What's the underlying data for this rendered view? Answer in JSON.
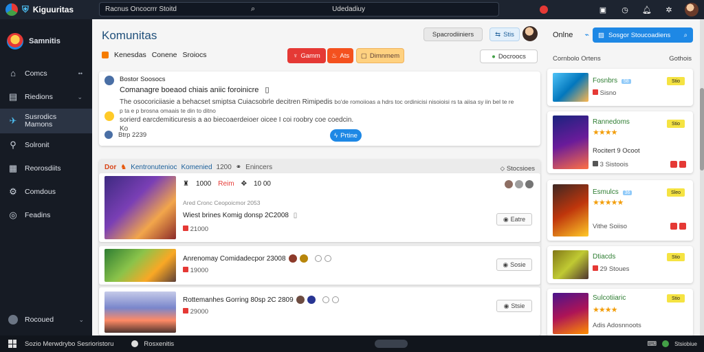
{
  "app": {
    "title": "Kiguuritas"
  },
  "search": {
    "query": "Racnus Oncocrrr Stoitd",
    "center": "Udedadiuy"
  },
  "sidebar": {
    "brand": "Samnitis",
    "items": [
      {
        "label": "Comcs",
        "icon": "home-icon"
      },
      {
        "label": "Riedions",
        "icon": "briefcase-icon"
      },
      {
        "label": "Susrodics Mamons",
        "icon": "controller-icon"
      },
      {
        "label": "Solronit",
        "icon": "wrench-icon"
      },
      {
        "label": "Reorosdiits",
        "icon": "shop-icon"
      },
      {
        "label": "Comdous",
        "icon": "gear-icon"
      },
      {
        "label": "Feadins",
        "icon": "target-icon"
      }
    ],
    "footer": "Rocoued"
  },
  "main": {
    "title": "Komunitas",
    "header_btn1": "Spacrodiiniers",
    "header_btn2": "Stis",
    "tabs_label1": "Kenesdas",
    "tabs_label2": "Conene",
    "tabs_label3": "Sroiocs",
    "pill1": "Gamm",
    "pill2": "Ats",
    "pill3": "Dimnmem",
    "pill4": "Docroocs",
    "colors": {
      "pill1": "#e53935",
      "pill2": "#f4511e",
      "pill3": "#ffd180",
      "accent": "#1e88e5"
    },
    "post": {
      "name": "Bostor Soosocs",
      "title": "Comanagre boeaod chiais aniic foroinicre",
      "body1": "The osocoriciiasie a behacset smiptsa Cuiacsobrle decitren Rimipedis ",
      "body_right": "bo'de romoiioas a hdrs toc ordinicisi nisoioisi rs ta aiisa sy iin bel te re p ta e p brosna omaais te din to ditno",
      "body2": "sorierd earcdemiticuresis a ao biecoaerdeioer oicee I coi roobry coe coedcin.",
      "body3": "Ko",
      "date": "Btrp 2239",
      "action": "Prtine"
    },
    "feed": {
      "label1": "Dor",
      "label2": "Kentronutenioc",
      "label3": "Komenied",
      "label4": "1200",
      "label5": "Enincers",
      "right": "Stocsioes",
      "rows": [
        {
          "line1a": "1000",
          "line1b": "Reim",
          "line1c": "10 00",
          "meta": "Ared Cronc Ceopoicmor 2053",
          "title": "Wiest brines Komig donsp 2C2008",
          "sub": "21000",
          "btn": "Eatre"
        },
        {
          "title": "Anrenomay Comidadecpor 23008",
          "sub": "19000",
          "btn": "Sosie"
        },
        {
          "title": "Rottemanhes Gorring 80sp 2C 2809",
          "sub": "29000",
          "btn": "Stsie"
        }
      ]
    }
  },
  "right": {
    "online": "Onlne",
    "search": "Sosgor Stoucoadiens",
    "sub1": "Cornbolo Ortens",
    "sub2": "Gothois",
    "games": [
      {
        "name": "Fosnbrs",
        "tag": "58",
        "sub": "Sisno",
        "badge": "Stio"
      },
      {
        "name": "Rannedoms",
        "tag": "",
        "sub": "Rocitert 9 Ocoot",
        "sub2": "3 Sistoois",
        "badge": "Stio"
      },
      {
        "name": "Esmulcs",
        "tag": "36",
        "sub": "Vithe Soiiso",
        "badge": "Sleo"
      },
      {
        "name": "Dtiacds",
        "tag": "",
        "sub": "29 Stoues",
        "badge": "Stio"
      },
      {
        "name": "Sulcotiiaric",
        "tag": "",
        "sub": "Adis Adosnnoots",
        "badge": "Stio"
      }
    ]
  },
  "taskbar": {
    "left": "Sozio Merwdrybo Sesrioristoru",
    "app": "Rosxenitis",
    "right": "Stsiobiue"
  }
}
